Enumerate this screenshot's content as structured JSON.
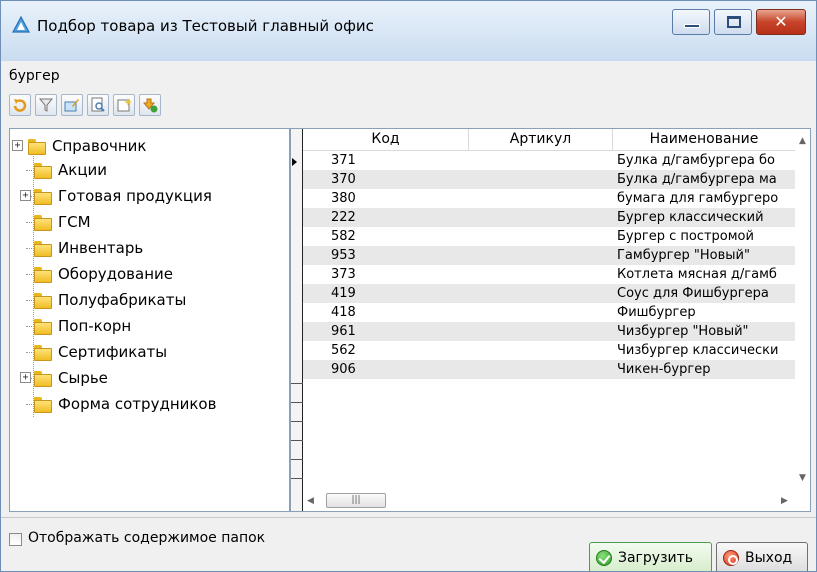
{
  "window": {
    "title": "Подбор товара из Тестовый главный офис"
  },
  "search": {
    "value": "бургер"
  },
  "toolbar": {
    "buttons": [
      "refresh-icon",
      "filter-icon",
      "edit-icon",
      "preview-icon",
      "add-icon",
      "export-icon"
    ]
  },
  "tree": {
    "root": "Справочник",
    "items": [
      "Акции",
      "Готовая продукция",
      "ГСМ",
      "Инвентарь",
      "Оборудование",
      "Полуфабрикаты",
      "Поп-корн",
      "Сертификаты",
      "Сырье",
      "Форма сотрудников"
    ]
  },
  "grid": {
    "columns": [
      "Код",
      "Артикул",
      "Наименование"
    ],
    "rows": [
      {
        "kod": "371",
        "artikul": "",
        "name": "Булка д/гамбургера бо"
      },
      {
        "kod": "370",
        "artikul": "",
        "name": "Булка д/гамбургера ма"
      },
      {
        "kod": "380",
        "artikul": "",
        "name": "бумага для гамбургеро"
      },
      {
        "kod": "222",
        "artikul": "",
        "name": "Бургер классический"
      },
      {
        "kod": "582",
        "artikul": "",
        "name": "Бургер с постромой"
      },
      {
        "kod": "953",
        "artikul": "",
        "name": "Гамбургер \"Новый\""
      },
      {
        "kod": "373",
        "artikul": "",
        "name": "Котлета мясная д/гамб"
      },
      {
        "kod": "419",
        "artikul": "",
        "name": "Соус для Фишбургера"
      },
      {
        "kod": "418",
        "artikul": "",
        "name": "Фишбургер"
      },
      {
        "kod": "961",
        "artikul": "",
        "name": "Чизбургер \"Новый\""
      },
      {
        "kod": "562",
        "artikul": "",
        "name": "Чизбургер классически"
      },
      {
        "kod": "906",
        "artikul": "",
        "name": "Чикен-бургер"
      }
    ]
  },
  "footer": {
    "checkbox_label": "Отображать содержимое папок",
    "checkbox_checked": false,
    "load_label": "Загрузить",
    "exit_label": "Выход"
  },
  "colors": {
    "accent": "#4f9d4f",
    "close": "#c7442a"
  }
}
